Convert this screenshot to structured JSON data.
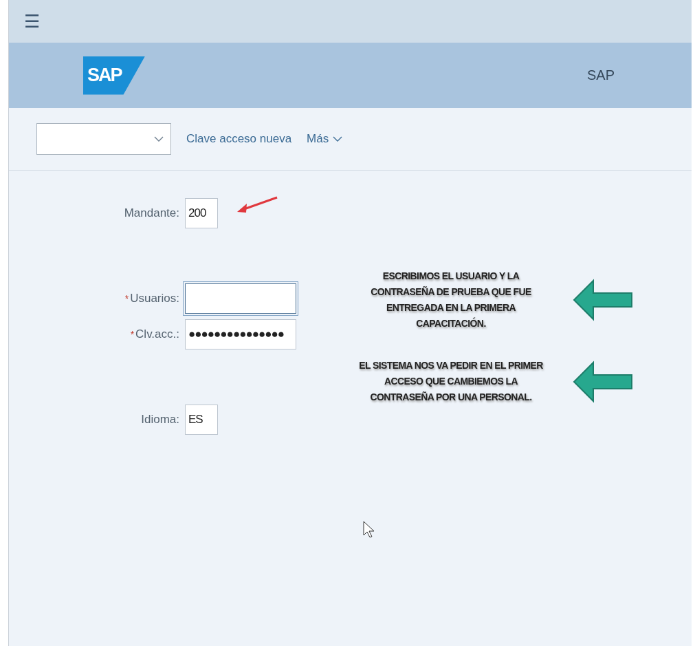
{
  "top_bar": {
    "menu_icon": "☰"
  },
  "header": {
    "logo": "SAP",
    "title": "SAP"
  },
  "toolbar": {
    "links": [
      {
        "label": "Clave acceso nueva",
        "kind": "link"
      },
      {
        "label": "Más",
        "kind": "menu"
      }
    ]
  },
  "form": {
    "fields": [
      {
        "label": "Mandante:",
        "value": "200",
        "focused": false,
        "kind": "short"
      },
      {
        "label": "Usuarios:",
        "marker": "*",
        "focused": true,
        "kind": "long"
      },
      {
        "label": "Clv.acc.:",
        "marker": "*",
        "value": "●●●●●●●●●●●●●●●",
        "focused": false,
        "kind": "long"
      },
      {
        "label": "Idioma:",
        "value": "ES",
        "focused": false,
        "kind": "short"
      }
    ]
  },
  "annotations": [
    {
      "text": "ESCRIBIMOS EL USUARIO Y LA CONTRASEÑA DE PRUEBA QUE FUE ENTREGADA EN LA PRIMERA CAPACITACIÓN."
    },
    {
      "text": "EL SISTEMA NOS VA PEDIR EN EL PRIMER ACCESO QUE CAMBIEMOS LA CONTRASEÑA POR UNA PERSONAL."
    }
  ]
}
